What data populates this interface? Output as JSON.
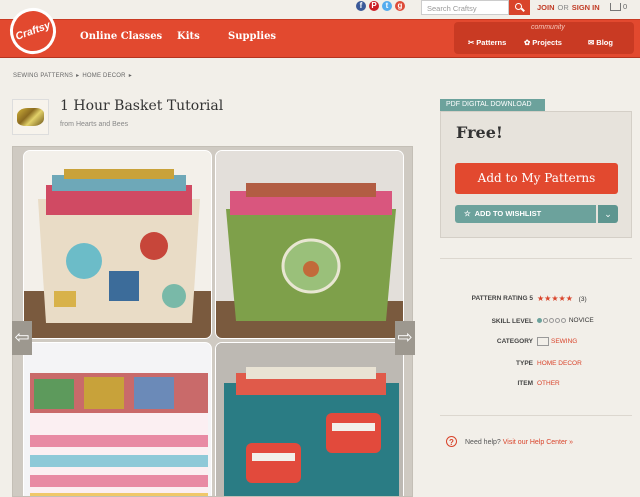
{
  "header": {
    "search_placeholder": "Search Craftsy",
    "join": "JOIN",
    "or": "OR",
    "sign_in": "SIGN IN",
    "cart_count": "0",
    "social": [
      {
        "name": "facebook-icon",
        "glyph": "f",
        "color": "#3b5998"
      },
      {
        "name": "pinterest-icon",
        "glyph": "P",
        "color": "#cb2027"
      },
      {
        "name": "twitter-icon",
        "glyph": "t",
        "color": "#55acee"
      },
      {
        "name": "google-plus-icon",
        "glyph": "g",
        "color": "#dd4b39"
      }
    ]
  },
  "nav": {
    "logo": "Craftsy",
    "online_classes": "Online Classes",
    "kits": "Kits",
    "supplies": "Supplies",
    "community_label": "community",
    "patterns": "Patterns",
    "projects": "Projects",
    "blog": "Blog"
  },
  "breadcrumb": [
    "SEWING PATTERNS",
    "HOME DECOR"
  ],
  "breadcrumb_sep": "▸",
  "pattern": {
    "title": "1 Hour Basket Tutorial",
    "from_prefix": "from",
    "author": "Hearts and Bees"
  },
  "purchase": {
    "tag": "PDF DIGITAL DOWNLOAD",
    "price": "Free!",
    "add_button": "Add to My Patterns",
    "wishlist_button": "ADD TO WISHLIST",
    "wishlist_star": "☆"
  },
  "details": {
    "rating_label": "PATTERN RATING",
    "rating_value": "5",
    "stars": "★★★★★",
    "rating_count": "(3)",
    "skill_label": "SKILL LEVEL",
    "skill_value": "NOVICE",
    "category_label": "CATEGORY",
    "category_value": "SEWING",
    "type_label": "TYPE",
    "type_value": "HOME DECOR",
    "item_label": "ITEM",
    "item_value": "OTHER"
  },
  "help": {
    "prefix": "Need help?",
    "link": "Visit our Help Center »"
  },
  "gallery": {
    "prev": "⇦",
    "next": "⇨"
  }
}
